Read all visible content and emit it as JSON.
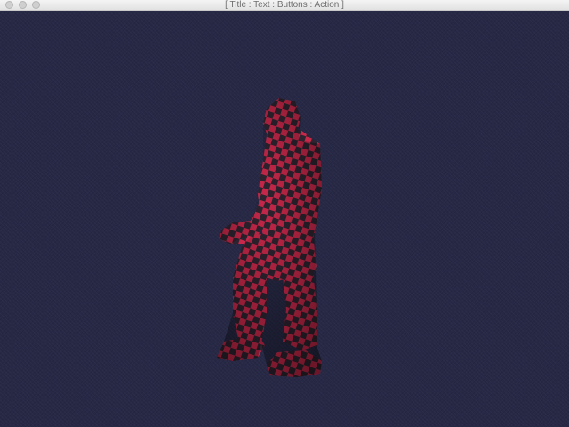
{
  "window": {
    "title": "[ Title : Text : Buttons : Action ]",
    "controls": [
      "close",
      "minimize",
      "zoom"
    ]
  },
  "viewport": {
    "background_color": "#262845",
    "model": {
      "name": "checkered-character-model",
      "pattern_colors": [
        "#c8284a",
        "#2e2430"
      ]
    }
  }
}
